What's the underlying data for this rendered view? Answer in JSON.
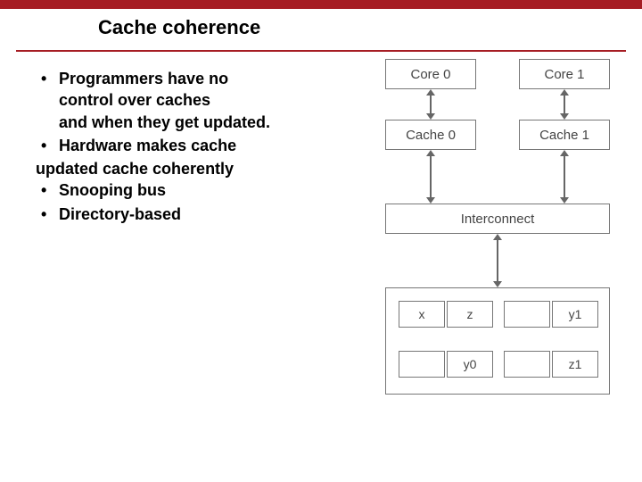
{
  "title": "Cache coherence",
  "bullets": {
    "b1_l1": "Programmers have no",
    "b1_l2": "control over caches",
    "b1_l3": "and when they get updated.",
    "b2_l1": "Hardware makes cache",
    "b2_cont": "updated cache coherently",
    "b3": "Snooping bus",
    "b4": "Directory-based"
  },
  "diagram": {
    "core0": "Core 0",
    "core1": "Core 1",
    "cache0": "Cache 0",
    "cache1": "Cache 1",
    "interconnect": "Interconnect",
    "mem": {
      "x": "x",
      "z": "z",
      "y1": "y1",
      "y0": "y0",
      "z1": "z1"
    }
  }
}
